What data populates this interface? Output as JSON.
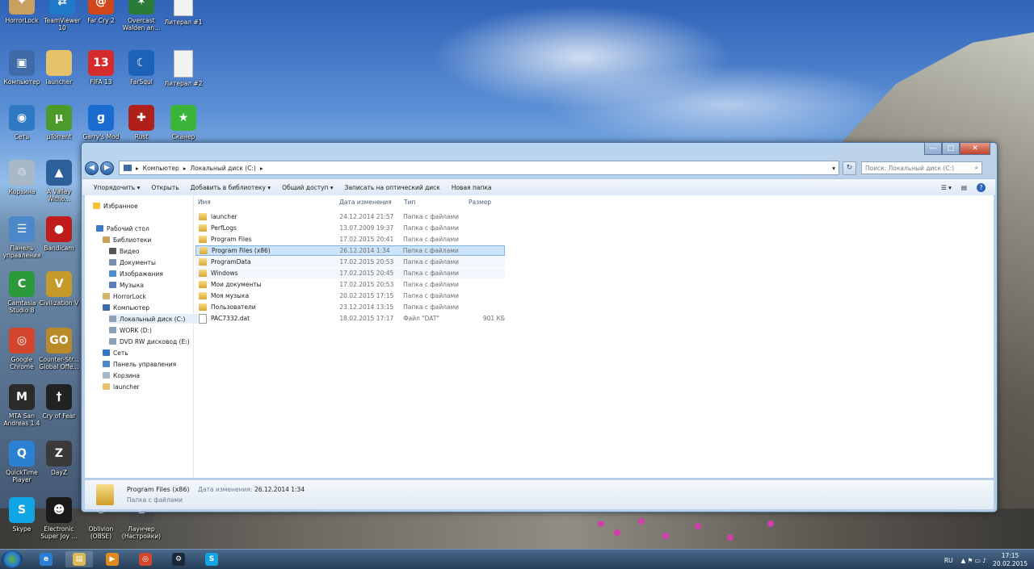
{
  "desktop": {
    "icons": [
      {
        "label": "HorrorLock",
        "color": "#c8a060",
        "glyph": "✦"
      },
      {
        "label": "TeamViewer 10",
        "color": "#1f7bc9",
        "glyph": "⇄"
      },
      {
        "label": "Far Cry 2",
        "color": "#d1461b",
        "glyph": "@"
      },
      {
        "label": "Overcast Walden an...",
        "color": "#2a7a3a",
        "glyph": "✶"
      },
      {
        "label": "Литерал #1",
        "color": "#f2f2f2",
        "glyph": ""
      },
      {
        "label": "Компьютер",
        "color": "#3e6aa8",
        "glyph": "▣"
      },
      {
        "label": "launcher",
        "color": "#e6c36a",
        "glyph": ""
      },
      {
        "label": "FIFA 13",
        "color": "#d52b2b",
        "glyph": "13"
      },
      {
        "label": "FarSqul",
        "color": "#1b62b8",
        "glyph": "☾"
      },
      {
        "label": "Литерал #2",
        "color": "#f2f2f2",
        "glyph": ""
      },
      {
        "label": "Сеть",
        "color": "#2f78c4",
        "glyph": "◉"
      },
      {
        "label": "µTorrent",
        "color": "#4c9a2a",
        "glyph": "µ"
      },
      {
        "label": "Garry's Mod",
        "color": "#1a6cd0",
        "glyph": "g"
      },
      {
        "label": "Rust",
        "color": "#b0201a",
        "glyph": "✚"
      },
      {
        "label": "Сканер",
        "color": "#3bb43a",
        "glyph": "★"
      },
      {
        "label": "Корзина",
        "color": "#a9b8c8",
        "glyph": "♲"
      },
      {
        "label": "A Valley Witho...",
        "color": "#2d5f9a",
        "glyph": "▲"
      },
      {
        "label": "Панель управления",
        "color": "#4c88c9",
        "glyph": "☰"
      },
      {
        "label": "Bandicam",
        "color": "#c01c1c",
        "glyph": "●"
      },
      {
        "label": "Camtasia Studio 8",
        "color": "#2a9a3a",
        "glyph": "C"
      },
      {
        "label": "Civilization V",
        "color": "#c59a2a",
        "glyph": "V"
      },
      {
        "label": "Google Chrome",
        "color": "#d4452d",
        "glyph": "◎"
      },
      {
        "label": "Counter-Str... Global Offe...",
        "color": "#b88a2a",
        "glyph": "GO"
      },
      {
        "label": "MTA San Andreas 1.4",
        "color": "#2b2b2b",
        "glyph": "M"
      },
      {
        "label": "Cry of Fear",
        "color": "#222222",
        "glyph": "†"
      },
      {
        "label": "QuickTime Player",
        "color": "#2a80d2",
        "glyph": "Q"
      },
      {
        "label": "DayZ",
        "color": "#3a3a3a",
        "glyph": "Z"
      },
      {
        "label": "Skype",
        "color": "#12a5e6",
        "glyph": "S"
      },
      {
        "label": "Electronic Super Joy ...",
        "color": "#1a1a1a",
        "glyph": "☻"
      },
      {
        "label": "Oblivion (OBSE)",
        "color": "#4d4a44",
        "glyph": "O"
      },
      {
        "label": "Лаунчер (Настройки)",
        "color": "#4a4a4a",
        "glyph": "L"
      }
    ]
  },
  "window": {
    "controls": {
      "minimize": "—",
      "maximize": "□",
      "close": "✕"
    },
    "address": {
      "back": "◀",
      "forward": "▶",
      "down": "▾",
      "crumbs": [
        "Компьютер",
        "Локальный диск (C:)"
      ],
      "sep": "▸",
      "refresh": "↻",
      "search_placeholder": "Поиск: Локальный диск (C:)",
      "search_icon": "⌕"
    },
    "toolbar": {
      "organize": "Упорядочить ▾",
      "open": "Открыть",
      "add_library": "Добавить в библиотеку ▾",
      "share": "Общий доступ ▾",
      "burn": "Записать на оптический диск",
      "new_folder": "Новая папка",
      "view": "☰ ▾",
      "pane": "▤",
      "help": "?"
    },
    "nav": [
      {
        "label": "Избранное",
        "indent": 0,
        "color": "#f2c23a"
      },
      {
        "label": "Рабочий стол",
        "indent": 0,
        "color": "#3e78c2"
      },
      {
        "label": "Библиотеки",
        "indent": 1,
        "color": "#c8a15a"
      },
      {
        "label": "Видео",
        "indent": 2,
        "color": "#555"
      },
      {
        "label": "Документы",
        "indent": 2,
        "color": "#7a8fb0"
      },
      {
        "label": "Изображения",
        "indent": 2,
        "color": "#4f8fc8"
      },
      {
        "label": "Музыка",
        "indent": 2,
        "color": "#5a7fb8"
      },
      {
        "label": "HorrorLock",
        "indent": 1,
        "color": "#d6b56a"
      },
      {
        "label": "Компьютер",
        "indent": 1,
        "color": "#3e6aa8"
      },
      {
        "label": "Локальный диск (C:)",
        "indent": 2,
        "color": "#8ca0b8"
      },
      {
        "label": "WORK (D:)",
        "indent": 2,
        "color": "#8ca0b8"
      },
      {
        "label": "DVD RW дисковод (E:)",
        "indent": 2,
        "color": "#8ca0b8"
      },
      {
        "label": "Сеть",
        "indent": 1,
        "color": "#2f78c4"
      },
      {
        "label": "Панель управления",
        "indent": 1,
        "color": "#4c88c9"
      },
      {
        "label": "Корзина",
        "indent": 1,
        "color": "#a9b8c8"
      },
      {
        "label": "launcher",
        "indent": 1,
        "color": "#e6c36a"
      }
    ],
    "columns": {
      "name": "Имя",
      "date": "Дата изменения",
      "type": "Тип",
      "size": "Размер"
    },
    "files": [
      {
        "name": "launcher",
        "date": "24.12.2014 21:57",
        "type": "Папка с файлами",
        "size": "",
        "kind": "folder"
      },
      {
        "name": "PerfLogs",
        "date": "13.07.2009 19:37",
        "type": "Папка с файлами",
        "size": "",
        "kind": "folder"
      },
      {
        "name": "Program Files",
        "date": "17.02.2015 20:41",
        "type": "Папка с файлами",
        "size": "",
        "kind": "folder"
      },
      {
        "name": "Program Files (x86)",
        "date": "26.12.2014 1:34",
        "type": "Папка с файлами",
        "size": "",
        "kind": "folder",
        "state": "selected"
      },
      {
        "name": "ProgramData",
        "date": "17.02.2015 20:53",
        "type": "Папка с файлами",
        "size": "",
        "kind": "folder",
        "state": "hover"
      },
      {
        "name": "Windows",
        "date": "17.02.2015 20:45",
        "type": "Папка с файлами",
        "size": "",
        "kind": "folder",
        "state": "hover"
      },
      {
        "name": "Мои документы",
        "date": "17.02.2015 20:53",
        "type": "Папка с файлами",
        "size": "",
        "kind": "folder"
      },
      {
        "name": "Моя музыка",
        "date": "20.02.2015 17:15",
        "type": "Папка с файлами",
        "size": "",
        "kind": "folder"
      },
      {
        "name": "Пользователи",
        "date": "23.12.2014 13:15",
        "type": "Папка с файлами",
        "size": "",
        "kind": "folder"
      },
      {
        "name": "PAC7332.dat",
        "date": "18.02.2015 17:17",
        "type": "Файл \"DAT\"",
        "size": "901 КБ",
        "kind": "file"
      }
    ],
    "details": {
      "name": "Program Files (x86)",
      "modified_label": "Дата изменения:",
      "modified_value": "26.12.2014 1:34",
      "type": "Папка с файлами"
    }
  },
  "taskbar": {
    "apps": [
      {
        "name": "ie",
        "color": "#2a7fd4",
        "glyph": "e"
      },
      {
        "name": "explorer",
        "color": "#d9b95a",
        "glyph": "▤"
      },
      {
        "name": "media",
        "color": "#e08a1e",
        "glyph": "▶"
      },
      {
        "name": "chrome",
        "color": "#d4452d",
        "glyph": "◎"
      },
      {
        "name": "steam",
        "color": "#1b2838",
        "glyph": "⚙"
      },
      {
        "name": "skype",
        "color": "#12a5e6",
        "glyph": "S"
      }
    ],
    "lang": "RU",
    "time": "17:15",
    "date": "20.02.2015"
  }
}
